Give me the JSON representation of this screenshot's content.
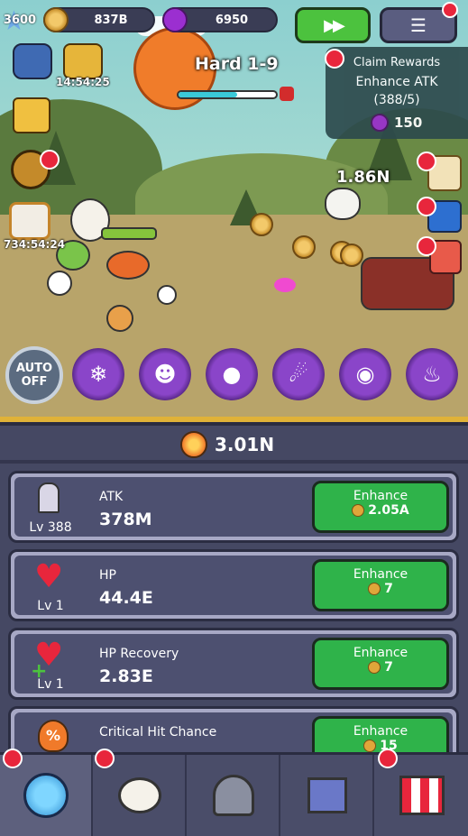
{
  "hud": {
    "level_badge": "3600",
    "gold": "837B",
    "gems": "6950",
    "timer1": "14:54:25",
    "timer2": "734:54:24"
  },
  "stage": {
    "label": "Hard 1-9"
  },
  "quest": {
    "title": "Claim Rewards",
    "task": "Enhance ATK",
    "progress": "(388/5)",
    "reward": "150"
  },
  "battle": {
    "damage_text": "1.86N",
    "auto_label_1": "AUTO",
    "auto_label_2": "OFF"
  },
  "power": {
    "value": "3.01N"
  },
  "stats": [
    {
      "name": "ATK",
      "level": "Lv 388",
      "value": "378M",
      "button": "Enhance",
      "cost": "2.05A",
      "icon": "sword-icon"
    },
    {
      "name": "HP",
      "level": "Lv 1",
      "value": "44.4E",
      "button": "Enhance",
      "cost": "7",
      "icon": "heart-icon"
    },
    {
      "name": "HP Recovery",
      "level": "Lv 1",
      "value": "2.83E",
      "button": "Enhance",
      "cost": "7",
      "icon": "heart-plus-icon"
    },
    {
      "name": "Critical Hit Chance",
      "level": "",
      "value": "",
      "button": "Enhance",
      "cost": "15",
      "icon": "crit-flame-icon"
    }
  ],
  "colors": {
    "accent_green": "#2fb34a",
    "panel": "#454863",
    "red_dot": "#e8263c"
  }
}
